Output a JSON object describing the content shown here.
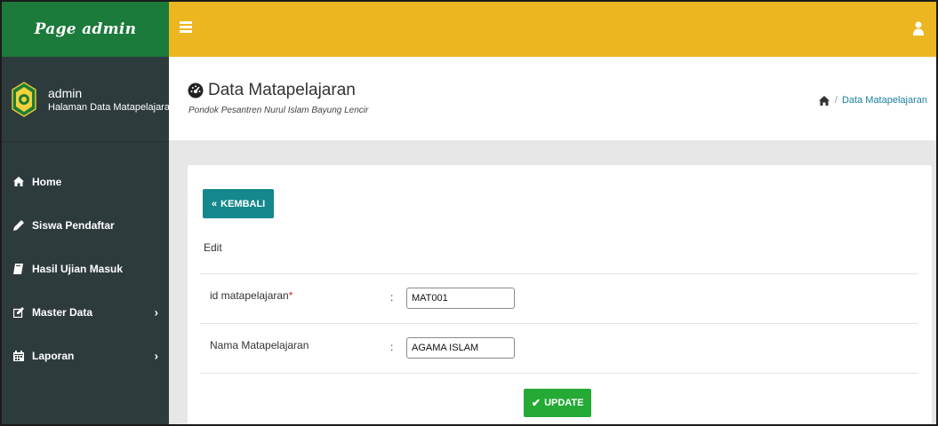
{
  "brand": {
    "title": "Page admin"
  },
  "user": {
    "name": "admin",
    "subtitle": "Halaman Data Matapelajaran"
  },
  "sidebar": {
    "items": [
      {
        "label": "Home",
        "icon": "home-icon"
      },
      {
        "label": "Siswa Pendaftar",
        "icon": "pencil-icon"
      },
      {
        "label": "Hasil Ujian Masuk",
        "icon": "book-icon"
      },
      {
        "label": "Master Data",
        "icon": "edit-icon",
        "has_submenu": true
      },
      {
        "label": "Laporan",
        "icon": "calendar-icon",
        "has_submenu": true
      }
    ]
  },
  "topbar": {
    "menu_icon": "hamburger-icon",
    "user_icon": "user-icon"
  },
  "header": {
    "title": "Data Matapelajaran",
    "subtitle": "Pondok Pesantren Nurul Islam Bayung Lencir",
    "title_icon": "dashboard-icon"
  },
  "breadcrumb": {
    "separator": "/",
    "current": "Data Matapelajaran"
  },
  "form": {
    "back_label": "KEMBALI",
    "section_label": "Edit",
    "fields": [
      {
        "label": "id matapelajaran",
        "required_mark": "*",
        "colon": ":",
        "value": "MAT001"
      },
      {
        "label": "Nama Matapelajaran",
        "colon": ":",
        "value": "AGAMA ISLAM"
      }
    ],
    "submit_label": "UPDATE"
  },
  "colors": {
    "brand_green": "#1c7a3a",
    "sidebar_bg": "#2e3b3d",
    "topbar_yellow": "#ecb621",
    "back_button_teal": "#14888c",
    "update_button_green": "#25aa36",
    "breadcrumb_link": "#1a7f9c"
  }
}
